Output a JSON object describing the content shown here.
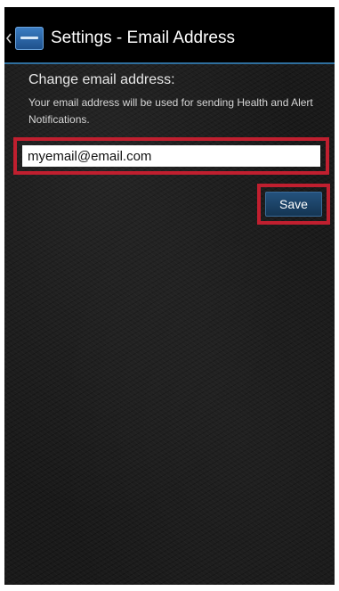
{
  "actionbar": {
    "title": "Settings - Email Address",
    "back_icon": "chevron-left-icon",
    "app_icon": "app-logo-icon"
  },
  "email_settings": {
    "heading": "Change email address:",
    "description": "Your email address will be used for sending Health and Alert Notifications.",
    "email_value": "myemail@email.com",
    "save_label": "Save"
  },
  "colors": {
    "accent": "#2f6f9e",
    "highlight": "#c01f2f",
    "button": "#1d4468"
  }
}
